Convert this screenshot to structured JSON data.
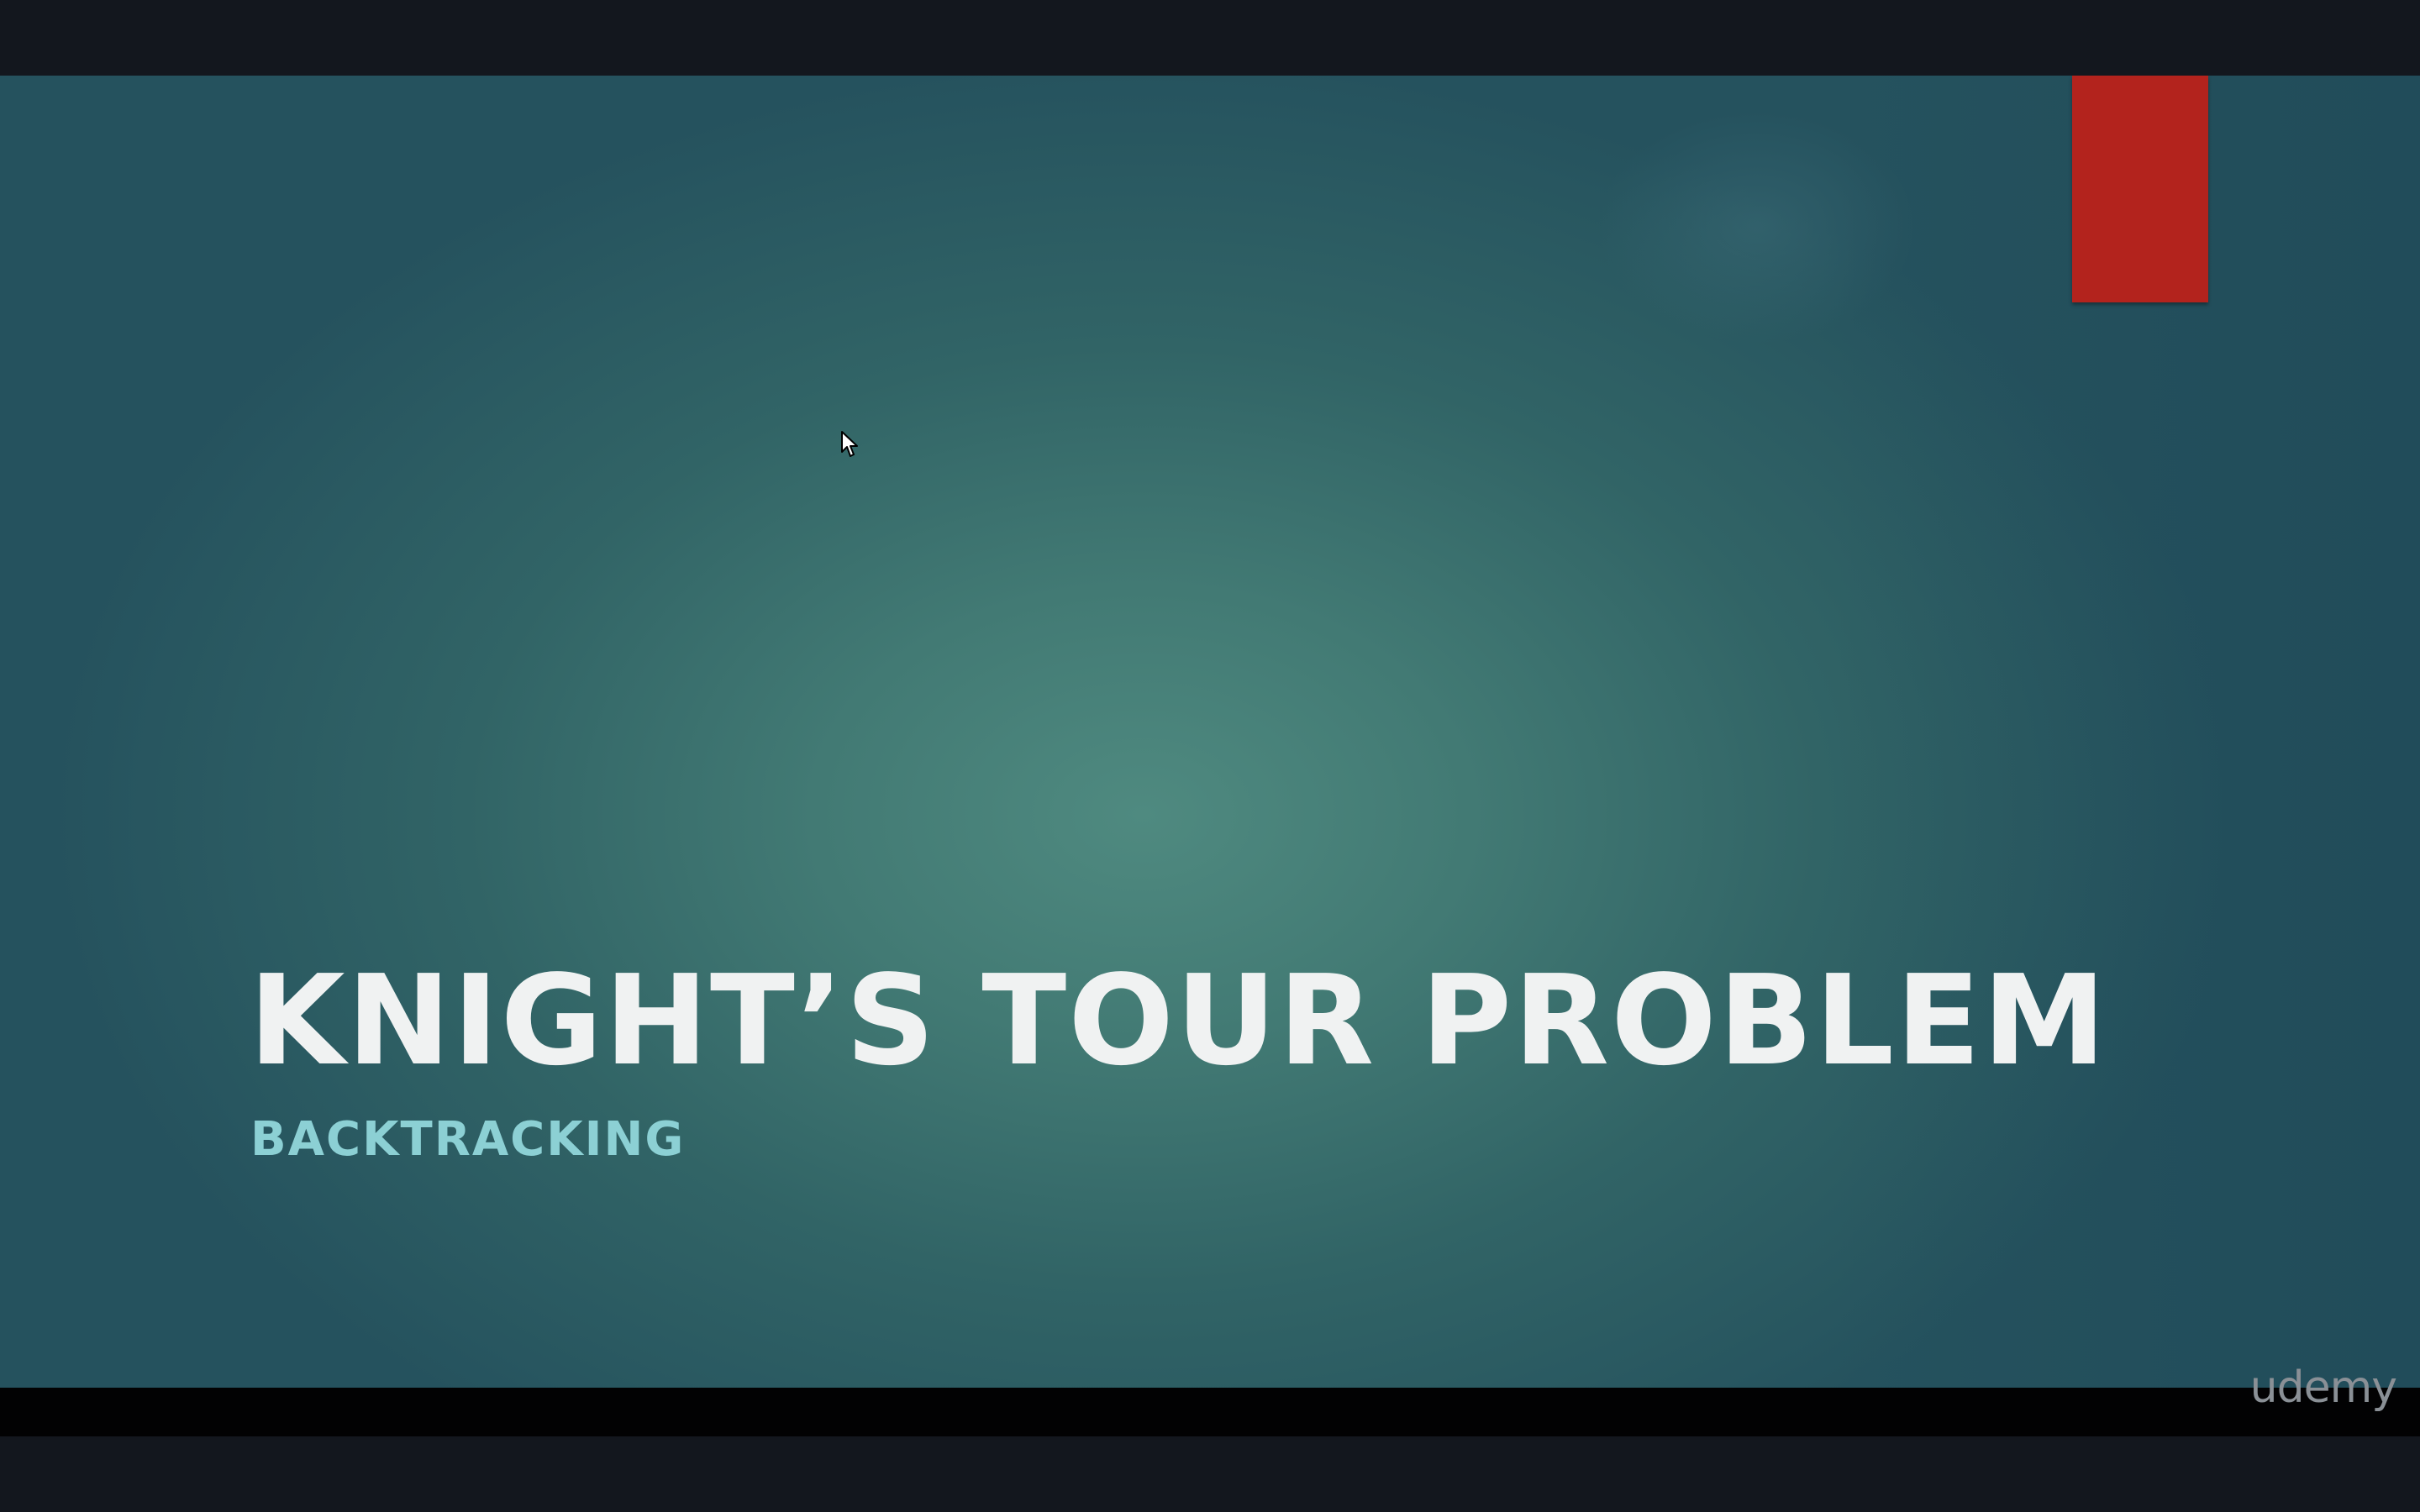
{
  "slide": {
    "title": "KNIGHT’S TOUR PROBLEM",
    "subtitle": "BACKTRACKING"
  },
  "watermark": {
    "text": "udemy"
  },
  "colors": {
    "background_center": "#4f8a80",
    "background_edge": "#25525e",
    "accent_tab": "#b3231d",
    "title": "#f0f2f2",
    "subtitle": "#8cd0d4",
    "letterbox": "#13171e"
  }
}
